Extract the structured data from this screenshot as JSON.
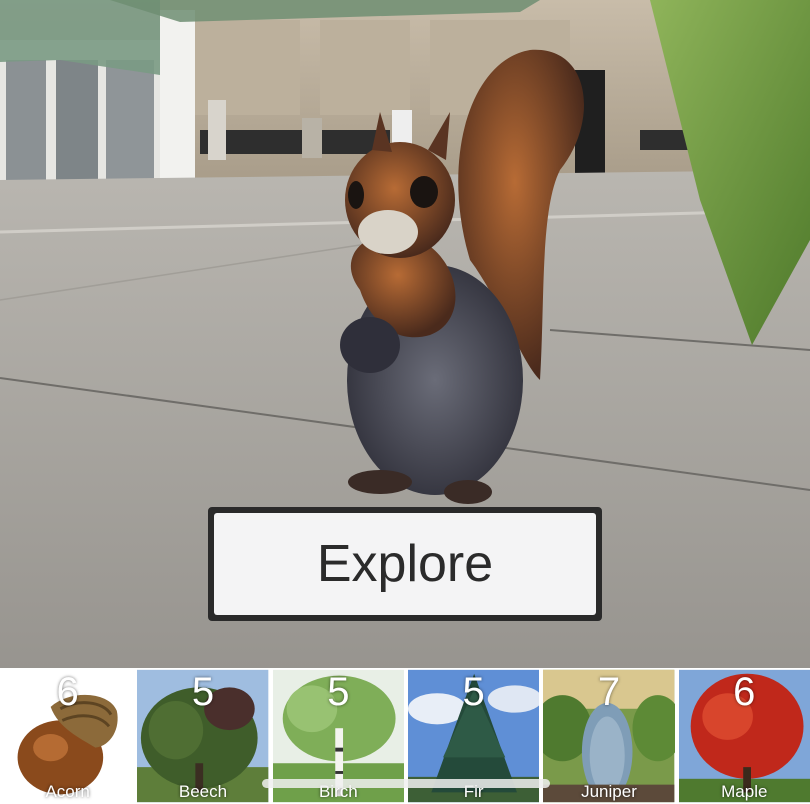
{
  "explore_button": {
    "label": "Explore"
  },
  "collection": {
    "items": [
      {
        "name": "Acorn",
        "count": "6",
        "icon": "acorn-icon"
      },
      {
        "name": "Beech",
        "count": "5",
        "icon": "beech-tree-icon"
      },
      {
        "name": "Birch",
        "count": "5",
        "icon": "birch-tree-icon"
      },
      {
        "name": "Fir",
        "count": "5",
        "icon": "fir-tree-icon"
      },
      {
        "name": "Juniper",
        "count": "7",
        "icon": "juniper-tree-icon"
      },
      {
        "name": "Maple",
        "count": "6",
        "icon": "maple-tree-icon"
      }
    ]
  },
  "colors": {
    "button_bg": "#f4f4f5",
    "button_border": "#2a2a2a",
    "label_text": "#ffffff"
  }
}
